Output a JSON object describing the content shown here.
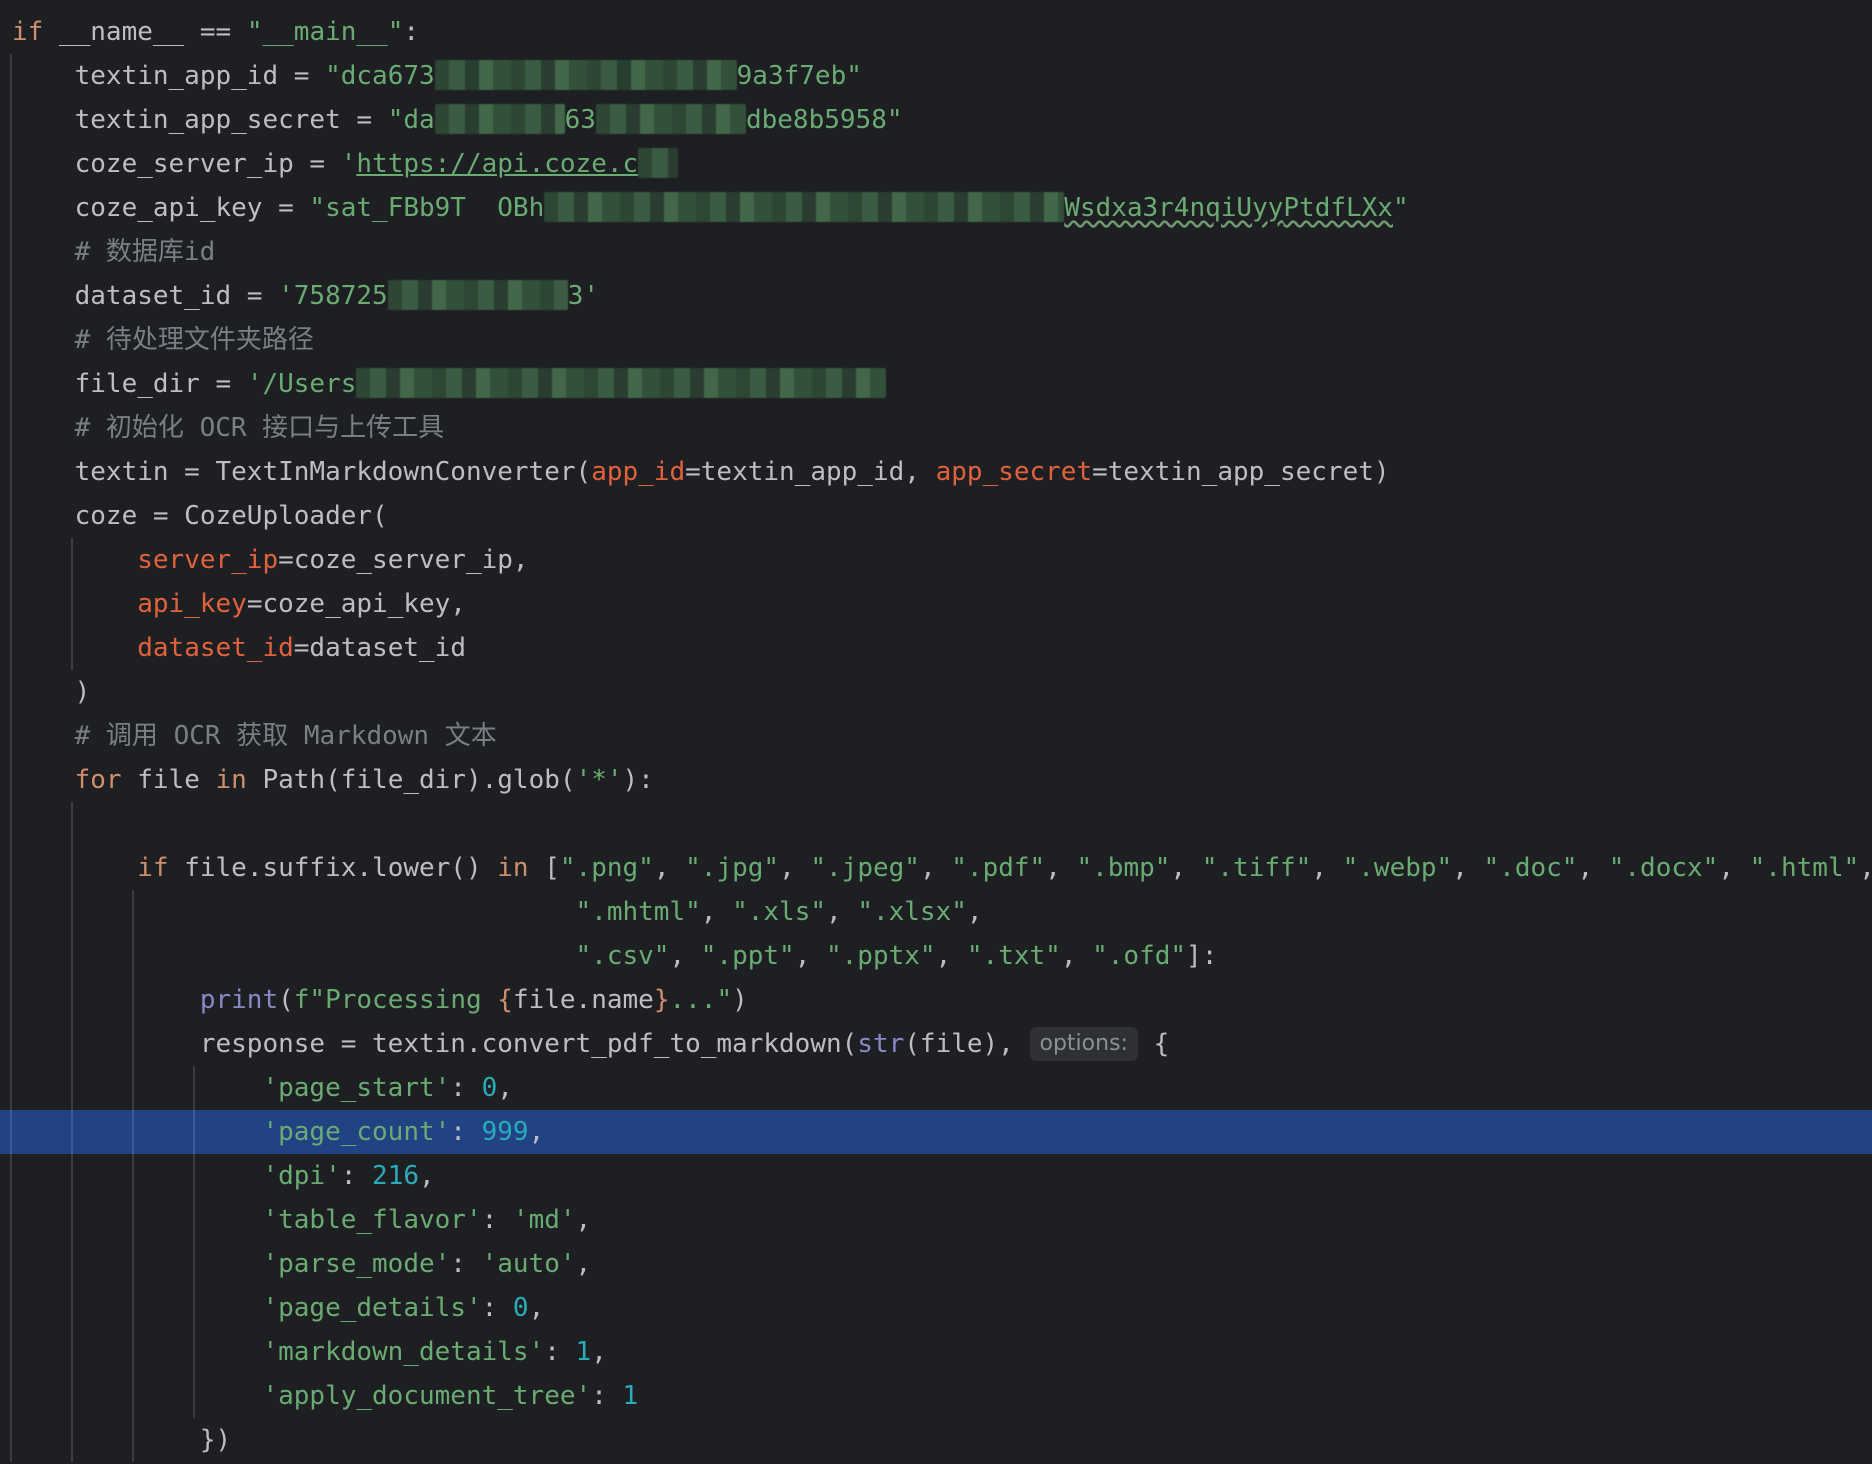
{
  "editor": {
    "line1": {
      "if": "if",
      "name": " __name__ ",
      "eq": "== ",
      "main": "\"__main__\"",
      "colon": ":"
    },
    "line2": {
      "lhs": "    textin_app_id = ",
      "open": "\"dca673",
      "close": "9a3f7eb\""
    },
    "line3": {
      "lhs": "    textin_app_secret = ",
      "open": "\"da",
      "mid": "63",
      "close": "dbe8b5958\""
    },
    "line4": {
      "lhs": "    coze_server_ip = ",
      "quote": "'",
      "url": "https://api.coze.c"
    },
    "line5": {
      "lhs": "    coze_api_key = ",
      "open": "\"sat_FBb9T  OBh",
      "typo1": "Wsdxa3r4nqiUyy",
      "typo2": "PtdfLXx",
      "close": "\""
    },
    "line6": {
      "comment": "    # 数据库id"
    },
    "line7": {
      "lhs": "    dataset_id = ",
      "open": "'758725",
      "close": "3'"
    },
    "line8": {
      "comment": "    # 待处理文件夹路径"
    },
    "line9": {
      "lhs": "    file_dir = ",
      "open": "'/Users"
    },
    "line10": {
      "comment": "    # 初始化 OCR 接口与上传工具"
    },
    "line11": {
      "a": "    textin = TextInMarkdownConverter(",
      "p1": "app_id",
      "b": "=textin_app_id, ",
      "p2": "app_secret",
      "c": "=textin_app_secret)"
    },
    "line12": {
      "text": "    coze = CozeUploader("
    },
    "line13": {
      "indent": "        ",
      "param": "server_ip",
      "rest": "=coze_server_ip,"
    },
    "line14": {
      "indent": "        ",
      "param": "api_key",
      "rest": "=coze_api_key,"
    },
    "line15": {
      "indent": "        ",
      "param": "dataset_id",
      "rest": "=dataset_id"
    },
    "line16": {
      "text": "    )"
    },
    "line17": {
      "comment": "    # 调用 OCR 获取 Markdown 文本"
    },
    "line18": {
      "indent": "    ",
      "for": "for",
      "a": " file ",
      "in": "in",
      "b": " Path(file_dir).glob(",
      "s": "'*'",
      "c": "):"
    },
    "line20": {
      "indent": "        ",
      "if": "if",
      "a": " file.suffix.lower() ",
      "in": "in",
      "b": " [",
      "items": [
        "\".png\"",
        "\".jpg\"",
        "\".jpeg\"",
        "\".pdf\"",
        "\".bmp\"",
        "\".tiff\"",
        "\".webp\"",
        "\".doc\"",
        "\".docx\"",
        "\".html\""
      ],
      "sep": ", ",
      "tail": ","
    },
    "line21": {
      "indent": "                                    ",
      "items": [
        "\".mhtml\"",
        "\".xls\"",
        "\".xlsx\""
      ],
      "sep": ", ",
      "tail": ","
    },
    "line22": {
      "indent": "                                    ",
      "items": [
        "\".csv\"",
        "\".ppt\"",
        "\".pptx\"",
        "\".txt\"",
        "\".ofd\""
      ],
      "sep": ", ",
      "tail": "]:"
    },
    "line23": {
      "indent": "            ",
      "print": "print",
      "a": "(",
      "fs": "f\"Processing ",
      "lb": "{",
      "expr": "file.name",
      "rb": "}",
      "fe": "...\"",
      "b": ")"
    },
    "line24": {
      "indent": "            ",
      "a": "response = textin.convert_pdf_to_markdown(",
      "str": "str",
      "b": "(file), ",
      "hint": "options:",
      "c": " {"
    },
    "dict": [
      {
        "key": "'page_start'",
        "val": "0",
        "tail": ",",
        "num": true
      },
      {
        "key": "'page_count'",
        "val": "999",
        "tail": ",",
        "num": true
      },
      {
        "key": "'dpi'",
        "val": "216",
        "tail": ",",
        "num": true
      },
      {
        "key": "'table_flavor'",
        "val": "'md'",
        "tail": ",",
        "num": false
      },
      {
        "key": "'parse_mode'",
        "val": "'auto'",
        "tail": ",",
        "num": false
      },
      {
        "key": "'page_details'",
        "val": "0",
        "tail": ",",
        "num": true
      },
      {
        "key": "'markdown_details'",
        "val": "1",
        "tail": ",",
        "num": true
      },
      {
        "key": "'apply_document_tree'",
        "val": "1",
        "tail": "",
        "num": true
      }
    ],
    "dict_indent": "                ",
    "dict_colon": ": ",
    "closing": {
      "indent": "            ",
      "text": "})"
    }
  }
}
